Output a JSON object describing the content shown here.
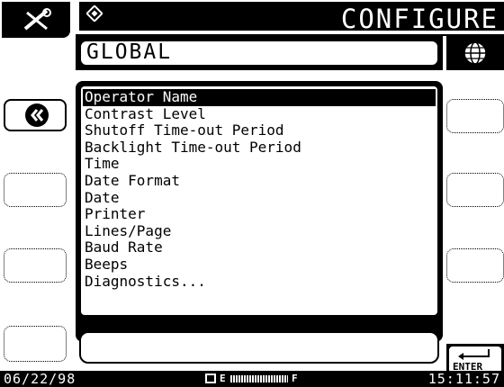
{
  "header": {
    "title": "CONFIGURE",
    "tools_icon": "tools-icon",
    "mode_icon": "diamond-icon"
  },
  "section": {
    "label": "GLOBAL",
    "globe_icon": "globe-icon"
  },
  "navigation": {
    "back_icon": "double-chevron-left-icon"
  },
  "menu": {
    "items": [
      "Operator Name",
      "Contrast Level",
      "Shutoff Time-out Period",
      "Backlight Time-out Period",
      "Time",
      "Date Format",
      "Date",
      "Printer",
      "Lines/Page",
      "Baud Rate",
      "Beeps",
      "Diagnostics..."
    ],
    "selected_index": 0
  },
  "enter_button": {
    "label": "ENTER",
    "icon": "enter-arrow-icon"
  },
  "status_bar": {
    "date": "06/22/98",
    "time": "15:11:57",
    "battery_empty_label": "E",
    "battery_full_label": "F",
    "battery_icon": "battery-icon",
    "battery_level": 1.0
  }
}
